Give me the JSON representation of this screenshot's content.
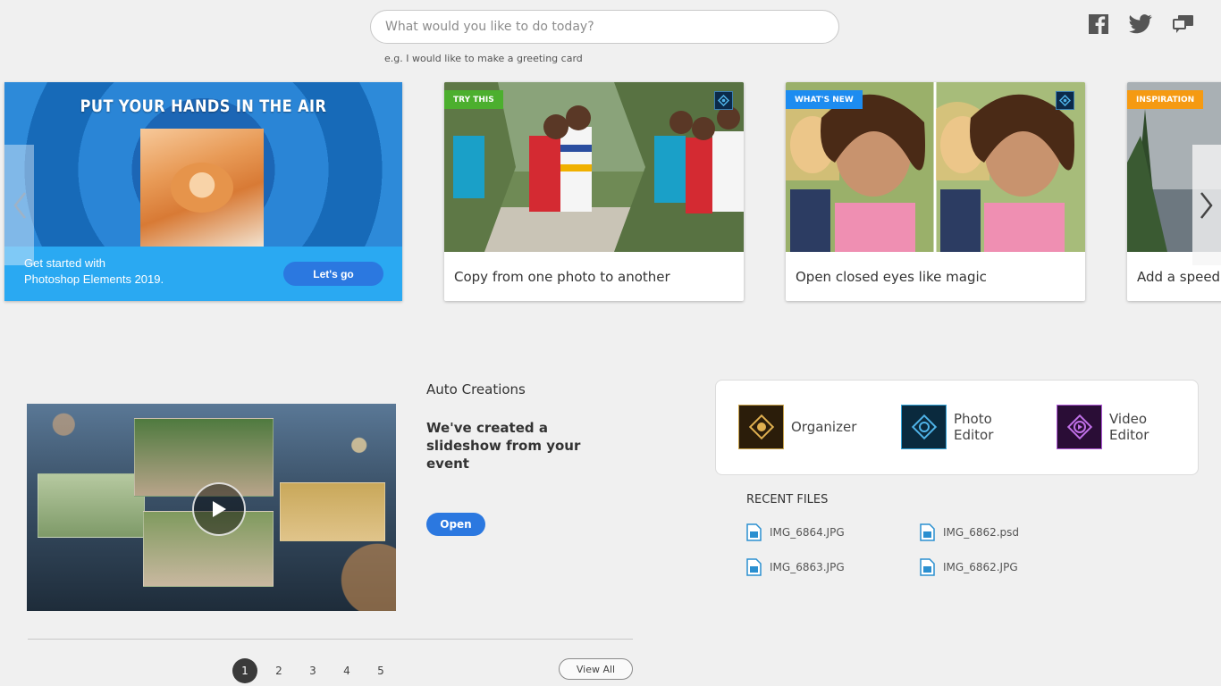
{
  "search": {
    "placeholder": "What would you like to do today?",
    "hint": "e.g. I would like to make a greeting card"
  },
  "social": {
    "facebook_icon": "facebook-icon",
    "twitter_icon": "twitter-icon",
    "feedback_icon": "feedback-icon"
  },
  "hero": {
    "title": "PUT YOUR HANDS IN THE AIR",
    "band_line1": "Get started with",
    "band_line2": "Photoshop Elements 2019.",
    "cta": "Let's go"
  },
  "cards": [
    {
      "tag": "TRY THIS",
      "caption": "Copy from one photo to another"
    },
    {
      "tag": "WHAT'S NEW",
      "caption": "Open closed eyes like magic"
    },
    {
      "tag": "INSPIRATION",
      "caption": "Add a speed"
    }
  ],
  "auto_creations": {
    "title": "Auto Creations",
    "description": "We've created a slideshow from your event",
    "open": "Open"
  },
  "pagination": {
    "pages": [
      "1",
      "2",
      "3",
      "4",
      "5"
    ],
    "active": "1",
    "view_all": "View All"
  },
  "apps": {
    "organizer": "Organizer",
    "photo_editor_1": "Photo",
    "photo_editor_2": "Editor",
    "video_editor_1": "Video",
    "video_editor_2": "Editor"
  },
  "recent_files": {
    "title": "RECENT FILES",
    "files": [
      "IMG_6864.JPG",
      "IMG_6862.psd",
      "IMG_6863.JPG",
      "IMG_6862.JPG"
    ]
  },
  "colors": {
    "accent_blue": "#2b78e0",
    "tag_green": "#4caf2e",
    "tag_blue": "#1d8cf0",
    "tag_orange": "#f59a12",
    "hero_band": "#2aa9f2"
  }
}
